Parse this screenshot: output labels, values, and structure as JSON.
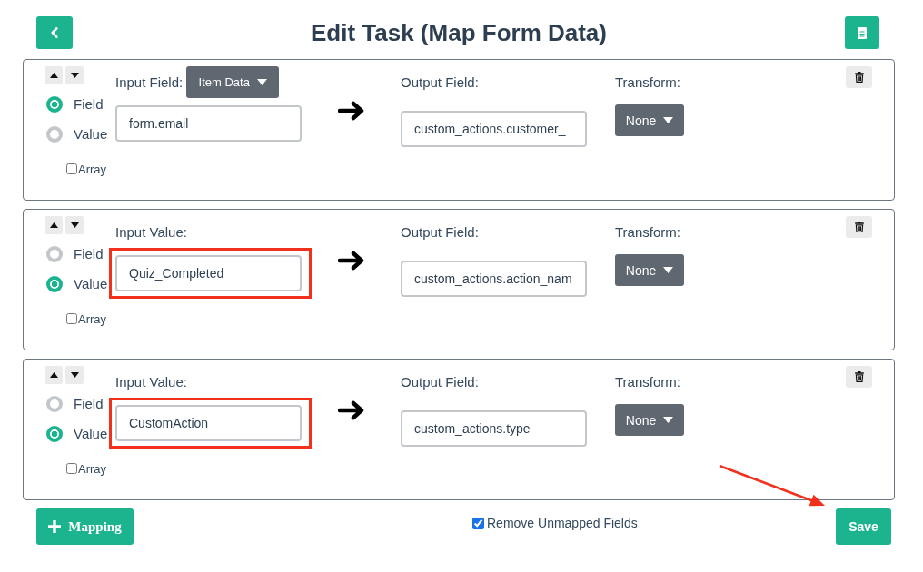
{
  "header": {
    "title": "Edit Task (Map Form Data)"
  },
  "mappings": [
    {
      "source_options": [
        {
          "label": "Field",
          "selected": true
        },
        {
          "label": "Value",
          "selected": false
        }
      ],
      "array": {
        "label": "Array",
        "checked": false
      },
      "input_label": "Input Field:",
      "input_type_dropdown": "Item Data",
      "input_value": "form.email",
      "highlighted": false,
      "output_label": "Output Field:",
      "output_value": "custom_actions.customer_",
      "transform_label": "Transform:",
      "transform": "None"
    },
    {
      "source_options": [
        {
          "label": "Field",
          "selected": false
        },
        {
          "label": "Value",
          "selected": true
        }
      ],
      "array": {
        "label": "Array",
        "checked": false
      },
      "input_label": "Input Value:",
      "input_value": "Quiz_Completed",
      "highlighted": true,
      "output_label": "Output Field:",
      "output_value": "custom_actions.action_nam",
      "transform_label": "Transform:",
      "transform": "None"
    },
    {
      "source_options": [
        {
          "label": "Field",
          "selected": false
        },
        {
          "label": "Value",
          "selected": true
        }
      ],
      "array": {
        "label": "Array",
        "checked": false
      },
      "input_label": "Input Value:",
      "input_value": "CustomAction",
      "highlighted": true,
      "output_label": "Output Field:",
      "output_value": "custom_actions.type",
      "transform_label": "Transform:",
      "transform": "None"
    }
  ],
  "footer": {
    "add_button": "Mapping",
    "remove_unmapped": {
      "label": "Remove Unmapped Fields",
      "checked": true
    },
    "save_button": "Save"
  },
  "annotations": [
    {
      "kind": "arrow"
    }
  ]
}
